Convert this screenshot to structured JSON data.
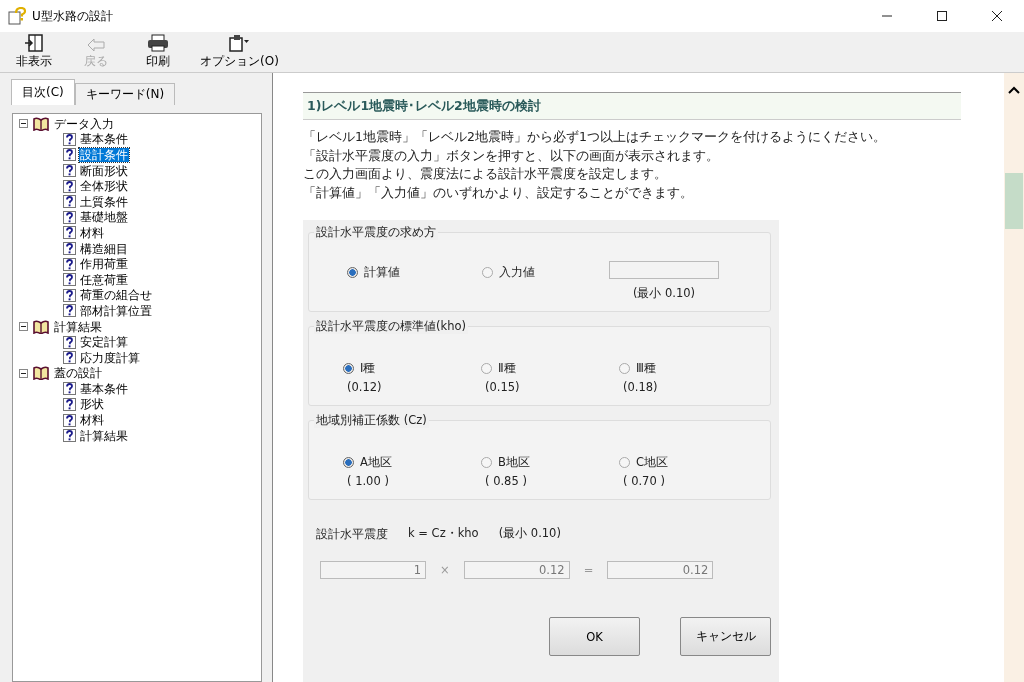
{
  "window": {
    "title": "U型水路の設計"
  },
  "toolbar": [
    {
      "kind": "hide",
      "label": "非表示",
      "disabled": false
    },
    {
      "kind": "back",
      "label": "戻る",
      "disabled": true
    },
    {
      "kind": "print",
      "label": "印刷",
      "disabled": false
    },
    {
      "kind": "options",
      "label": "オプション(O)",
      "disabled": false
    }
  ],
  "nav_tabs": [
    {
      "label": "目次(C)",
      "selected": true
    },
    {
      "label": "キーワード(N)",
      "selected": false
    }
  ],
  "tree": [
    {
      "label": "データ入力",
      "expanded": true,
      "selected": false,
      "children": [
        {
          "label": "基本条件",
          "selected": false
        },
        {
          "label": "設計条件",
          "selected": true
        },
        {
          "label": "断面形状",
          "selected": false
        },
        {
          "label": "全体形状",
          "selected": false
        },
        {
          "label": "土質条件",
          "selected": false
        },
        {
          "label": "基礎地盤",
          "selected": false
        },
        {
          "label": "材料",
          "selected": false
        },
        {
          "label": "構造細目",
          "selected": false
        },
        {
          "label": "作用荷重",
          "selected": false
        },
        {
          "label": "任意荷重",
          "selected": false
        },
        {
          "label": "荷重の組合せ",
          "selected": false
        },
        {
          "label": "部材計算位置",
          "selected": false
        }
      ]
    },
    {
      "label": "計算結果",
      "expanded": true,
      "selected": false,
      "children": [
        {
          "label": "安定計算",
          "selected": false
        },
        {
          "label": "応力度計算",
          "selected": false
        }
      ]
    },
    {
      "label": "蓋の設計",
      "expanded": true,
      "selected": false,
      "children": [
        {
          "label": "基本条件",
          "selected": false
        },
        {
          "label": "形状",
          "selected": false
        },
        {
          "label": "材料",
          "selected": false
        },
        {
          "label": "計算結果",
          "selected": false
        }
      ]
    }
  ],
  "content": {
    "heading": "1)レベル1地震時･レベル2地震時の検討",
    "paragraphs": [
      "「レベル1地震時」「レベル2地震時」から必ず1つ以上はチェックマークを付けるようにください。",
      "「設計水平震度の入力」ボタンを押すと、以下の画面が表示されます。",
      "この入力画面より、震度法による設計水平震度を設定します。",
      "「計算値」「入力値」のいずれかより、設定することができます。"
    ],
    "dialog": {
      "groups": [
        {
          "title": "設計水平震度の求め方",
          "kind": "method",
          "options": [
            {
              "label": "計算値",
              "selected": true
            },
            {
              "label": "入力値",
              "selected": false
            }
          ],
          "note": "(最小 0.10)"
        },
        {
          "title": "設計水平震度の標準値(kho)",
          "kind": "valued",
          "options": [
            {
              "label": "Ⅰ種",
              "value": "(0.12)",
              "selected": true
            },
            {
              "label": "Ⅱ種",
              "value": "(0.15)",
              "selected": false
            },
            {
              "label": "Ⅲ種",
              "value": "(0.18)",
              "selected": false
            }
          ]
        },
        {
          "title": "地域別補正係数 (Cz)",
          "kind": "valued",
          "options": [
            {
              "label": "A地区",
              "value": "( 1.00 )",
              "selected": true
            },
            {
              "label": "B地区",
              "value": "( 0.85 )",
              "selected": false
            },
            {
              "label": "C地区",
              "value": "( 0.70 )",
              "selected": false
            }
          ]
        }
      ],
      "result": {
        "label": "設計水平震度",
        "formula": "k = Cz・kho",
        "note": "(最小 0.10)",
        "fields": [
          "1",
          "0.12",
          "0.12"
        ],
        "operators": [
          "×",
          "="
        ]
      },
      "buttons": [
        "OK",
        "キャンセル"
      ]
    }
  }
}
